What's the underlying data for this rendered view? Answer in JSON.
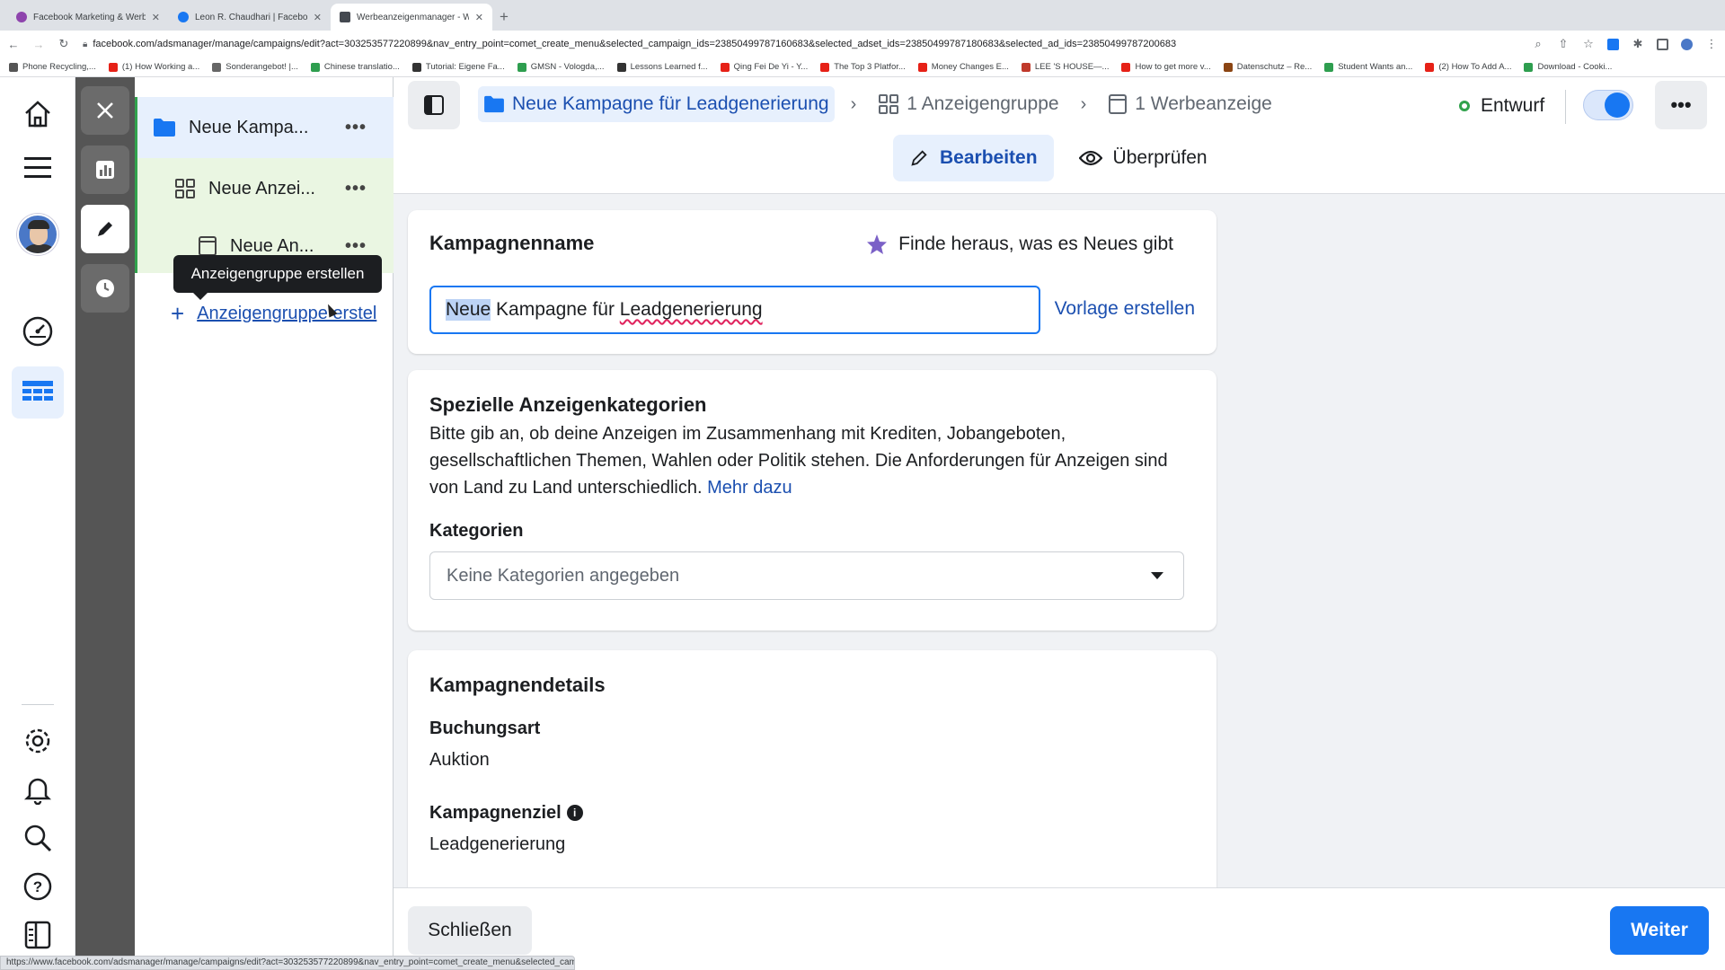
{
  "browser": {
    "tabs": [
      {
        "title": "Facebook Marketing & Werbea",
        "color": "#8e44ad"
      },
      {
        "title": "Leon R. Chaudhari | Facebook",
        "color": "#1877f2"
      },
      {
        "title": "Werbeanzeigenmanager - Wer",
        "color": "#444950"
      }
    ],
    "url": "facebook.com/adsmanager/manage/campaigns/edit?act=303253577220899&nav_entry_point=comet_create_menu&selected_campaign_ids=23850499787160683&selected_adset_ids=23850499787180683&selected_ad_ids=23850499787200683",
    "bookmarks": [
      {
        "label": "Phone Recycling,...",
        "color": "#555"
      },
      {
        "label": "(1) How Working a...",
        "color": "#e62117"
      },
      {
        "label": "Sonderangebot! |...",
        "color": "#666"
      },
      {
        "label": "Chinese translatio...",
        "color": "#2e9e4f"
      },
      {
        "label": "Tutorial: Eigene Fa...",
        "color": "#333"
      },
      {
        "label": "GMSN - Vologda,...",
        "color": "#2e9e4f"
      },
      {
        "label": "Lessons Learned f...",
        "color": "#333"
      },
      {
        "label": "Qing Fei De Yi - Y...",
        "color": "#e62117"
      },
      {
        "label": "The Top 3 Platfor...",
        "color": "#e62117"
      },
      {
        "label": "Money Changes E...",
        "color": "#e62117"
      },
      {
        "label": "LEE 'S HOUSE—...",
        "color": "#c0392b"
      },
      {
        "label": "How to get more v...",
        "color": "#e62117"
      },
      {
        "label": "Datenschutz – Re...",
        "color": "#8b4513"
      },
      {
        "label": "Student Wants an...",
        "color": "#2e9e4f"
      },
      {
        "label": "(2) How To Add A...",
        "color": "#e62117"
      },
      {
        "label": "Download - Cooki...",
        "color": "#2e9e4f"
      }
    ],
    "status_url": "https://www.facebook.com/adsmanager/manage/campaigns/edit?act=303253577220899&nav_entry_point=comet_create_menu&selected_campai..."
  },
  "tree": {
    "campaign": "Neue Kampa...",
    "adset": "Neue Anzei...",
    "ad": "Neue An...",
    "more": "•••",
    "add_label": "Anzeigengruppe erstel",
    "tooltip": "Anzeigengruppe erstellen"
  },
  "header": {
    "breadcrumb_campaign": "Neue Kampagne für Leadgenerierung",
    "breadcrumb_adset": "1 Anzeigengruppe",
    "breadcrumb_ad": "1 Werbeanzeige",
    "status": "Entwurf",
    "toggle_on": true,
    "more": "•••",
    "tab_edit": "Bearbeiten",
    "tab_review": "Überprüfen"
  },
  "campaign_name_card": {
    "title": "Kampagnenname",
    "whats_new": "Finde heraus, was es Neues gibt",
    "input_selected": "Neue",
    "input_mid": " Kampagne für ",
    "input_squiggle": "Leadgenerierung",
    "template_link": "Vorlage erstellen"
  },
  "special_card": {
    "title": "Spezielle Anzeigenkategorien",
    "description": "Bitte gib an, ob deine Anzeigen im Zusammenhang mit Krediten, Jobangeboten, gesellschaftlichen Themen, Wahlen oder Politik stehen. Die Anforderungen für Anzeigen sind von Land zu Land unterschiedlich.",
    "more_link": "Mehr dazu",
    "categories_label": "Kategorien",
    "categories_value": "Keine Kategorien angegeben"
  },
  "details_card": {
    "title": "Kampagnendetails",
    "booking_label": "Buchungsart",
    "booking_value": "Auktion",
    "objective_label": "Kampagnenziel",
    "objective_value": "Leadgenerierung"
  },
  "footer": {
    "close": "Schließen",
    "next": "Weiter"
  },
  "colors": {
    "brand_blue": "#1877f2",
    "link_blue": "#1b4fb0",
    "status_green": "#31a24c"
  }
}
